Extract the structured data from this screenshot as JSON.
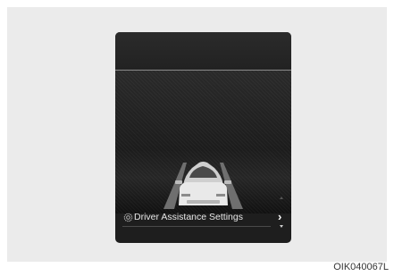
{
  "menu": {
    "label": "Driver Assistance Settings",
    "icon": "gear-icon",
    "nav_icon": "chevron-right-icon"
  },
  "figure_code": "OIK040067L",
  "colors": {
    "screen_bg": "#1e1e1e",
    "text": "#e6e6e6",
    "panel_bg": "#ebebeb"
  }
}
